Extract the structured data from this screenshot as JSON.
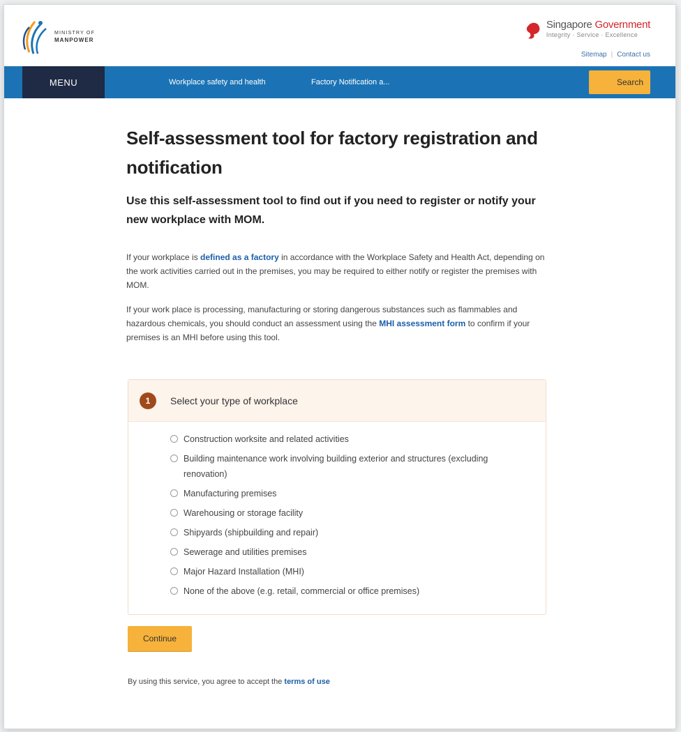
{
  "header": {
    "logo_line1": "MINISTRY OF",
    "logo_line2": "MANPOWER",
    "gov_title_part1": "Singapore ",
    "gov_title_part2": "Government",
    "gov_tagline": "Integrity · Service · Excellence",
    "sitemap": "Sitemap",
    "separator": "|",
    "contact": "Contact us"
  },
  "nav": {
    "menu": "MENU",
    "link1": "Workplace safety and health",
    "link2": "Factory Notification a...",
    "search": "Search"
  },
  "main": {
    "title": "Self-assessment tool for factory registration and notification",
    "subtitle": "Use this self-assessment tool to find out if you need to register or notify your new workplace with MOM.",
    "p1_before": "If your workplace is ",
    "p1_link": "defined as a factory",
    "p1_after": " in accordance with the Workplace Safety and Health Act, depending on the work activities carried out in the premises, you may be required to either notify or register the premises with MOM.",
    "p2_before": "If your work place is processing, manufacturing or storing dangerous substances such as flammables and hazardous chemicals, you should conduct an assessment using the ",
    "p2_link": "MHI assessment form",
    "p2_after": " to confirm if your premises is an MHI before using this tool."
  },
  "question": {
    "step": "1",
    "label": "Select your type of workplace",
    "options": [
      "Construction worksite and related activities",
      "Building maintenance work involving building exterior and structures (excluding renovation)",
      "Manufacturing premises",
      "Warehousing or storage facility",
      "Shipyards (shipbuilding and repair)",
      "Sewerage and utilities premises",
      "Major Hazard Installation (MHI)",
      "None of the above (e.g. retail, commercial or office premises)"
    ]
  },
  "actions": {
    "continue": "Continue"
  },
  "footer": {
    "before": "By using this service, you agree to accept the ",
    "link": "terms of use"
  },
  "colors": {
    "nav_blue": "#1b73b5",
    "menu_navy": "#1f2a44",
    "button_orange": "#f6b23a",
    "link_blue": "#1c5fa8",
    "step_brown": "#a04a1c",
    "gov_red": "#d4262b"
  }
}
